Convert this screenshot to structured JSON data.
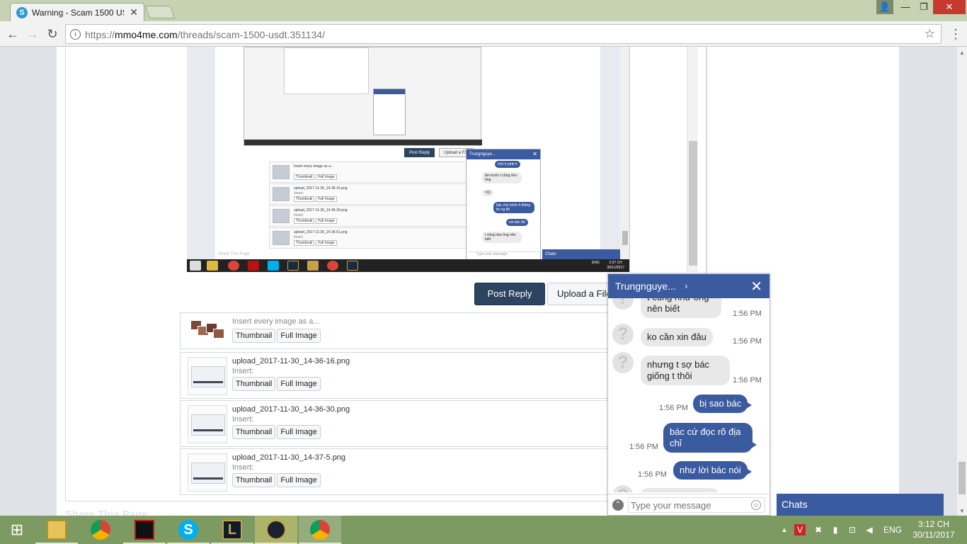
{
  "browser": {
    "tab_title": "Warning - Scam 1500 USDT",
    "url_prefix": "https://",
    "url_domain": "mmo4me.com",
    "url_path": "/threads/scam-1500-usdt.351134/"
  },
  "embedded_screenshot": {
    "post_reply": "Post Reply",
    "upload": "Upload a File",
    "chat_name": "Trungnguye...",
    "attachments": [
      {
        "name": "Insert every image as a...",
        "sub": "",
        "buttons": [
          "Thumbnail",
          "Full Image"
        ]
      },
      {
        "name": "upload_2017-11-30_14-36-16.png",
        "sub": "Insert:",
        "buttons": [
          "Thumbnail",
          "Full Image"
        ]
      },
      {
        "name": "upload_2017-11-30_14-36-30.png",
        "sub": "Insert:",
        "buttons": [
          "Thumbnail",
          "Full Image"
        ]
      },
      {
        "name": "upload_2017-11-30_14-36-51.png",
        "sub": "Insert:",
        "buttons": [
          "Thumbnail",
          "Full Image"
        ]
      }
    ],
    "messages": [
      {
        "text": "chứ k phải ít",
        "dir": "out"
      },
      {
        "text": "lần trước t cũng như ông",
        "dir": "in",
        "time": "1:55 PM"
      },
      {
        "text": "=)))",
        "dir": "in",
        "time": "1:55 PM"
      },
      {
        "text": "bác cho mình ít thông tin ng đó",
        "dir": "out",
        "time": "1:55 PM"
      },
      {
        "text": "xin bác đó",
        "dir": "out",
        "time": "1:55 PM"
      },
      {
        "text": "t cũng như ông nên biết",
        "dir": "in",
        "time": "1:56 PM"
      }
    ],
    "input_placeholder": "Type your message",
    "share": "Share This Page",
    "chats": "Chats",
    "clock_time": "2:37 CH",
    "clock_date": "30/11/2017",
    "lang": "ENG"
  },
  "post": {
    "post_reply": "Post Reply",
    "upload": "Upload a File",
    "share": "Share This Page"
  },
  "attachments": [
    {
      "name": "Insert every image as a...",
      "sub": "",
      "thumbnail": "Thumbnail",
      "full": "Full Image"
    },
    {
      "name": "upload_2017-11-30_14-36-16.png",
      "sub": "Insert:",
      "thumbnail": "Thumbnail",
      "full": "Full Image"
    },
    {
      "name": "upload_2017-11-30_14-36-30.png",
      "sub": "Insert:",
      "thumbnail": "Thumbnail",
      "full": "Full Image"
    },
    {
      "name": "upload_2017-11-30_14-37-5.png",
      "sub": "Insert:",
      "thumbnail": "Thumbnail",
      "full": "Full Image"
    }
  ],
  "chat": {
    "name": "Trungnguye...",
    "messages": [
      {
        "text": "t cũng như ông nên biết",
        "dir": "in",
        "time": "1:56 PM"
      },
      {
        "text": "ko cần xin đâu",
        "dir": "in",
        "time": "1:56 PM"
      },
      {
        "text": "nhưng t sợ bác giống t thôi",
        "dir": "in",
        "time": "1:56 PM"
      },
      {
        "text": "bị sao bác",
        "dir": "out",
        "time": "1:56 PM"
      },
      {
        "text": "bác cứ đọc rõ địa chỉ",
        "dir": "out",
        "time": "1:56 PM"
      },
      {
        "text": "như lời bác nói",
        "dir": "out",
        "time": "1:56 PM"
      }
    ],
    "input_placeholder": "Type your message"
  },
  "chats_bar": "Chats",
  "taskbar": {
    "apps": [
      "file-explorer",
      "chrome",
      "garena",
      "skype",
      "league-of-legends",
      "league-client",
      "chrome-active"
    ],
    "lang": "ENG",
    "time": "3:12 CH",
    "date": "30/11/2017"
  },
  "colors": {
    "accent": "#3b5ba0",
    "post_button": "#2c4460",
    "taskbar": "#7e9a63",
    "titlebar": "#c6d2b2"
  }
}
